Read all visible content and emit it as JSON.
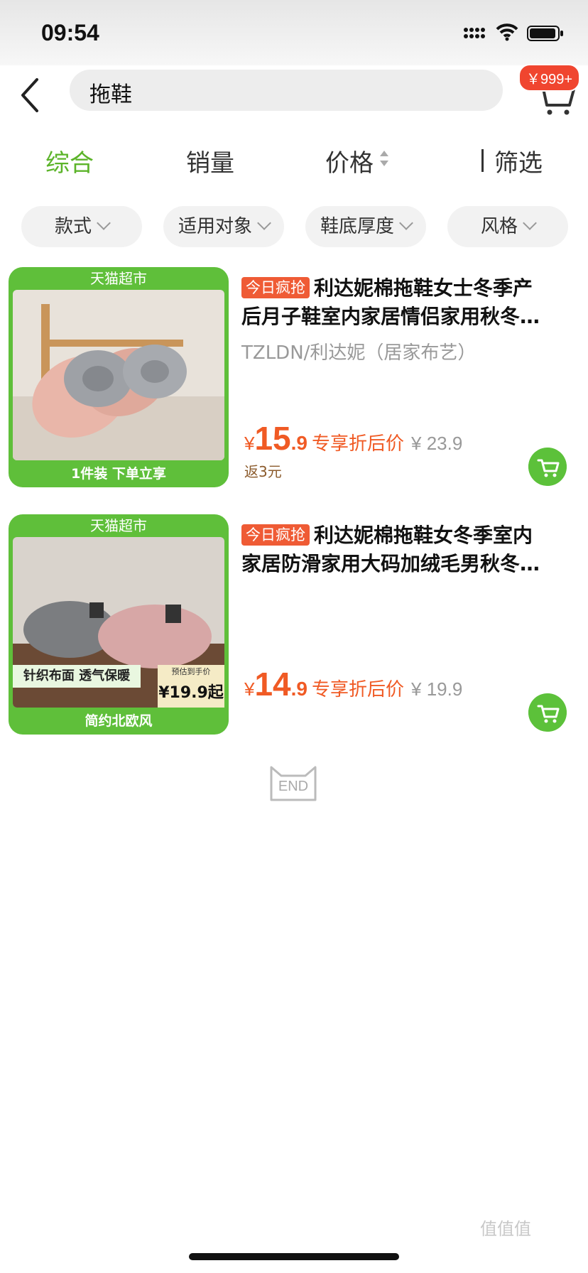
{
  "status_bar": {
    "time": "09:54"
  },
  "header": {
    "search_query": "拖鞋",
    "cart_badge": "￥999+"
  },
  "sort_tabs": [
    {
      "label": "综合",
      "active": true
    },
    {
      "label": "销量",
      "active": false
    },
    {
      "label": "价格",
      "active": false
    },
    {
      "label": "筛选",
      "active": false
    }
  ],
  "filter_chips": [
    "款式",
    "适用对象",
    "鞋底厚度",
    "风格"
  ],
  "products": [
    {
      "thumb_top": "天猫超市",
      "thumb_bottom": "1件装   下单立享",
      "promo": "今日疯抢",
      "title_line1": "利达妮棉拖鞋女士冬季产",
      "title_line2": "后月子鞋室内家居情侣家用秋冬…",
      "brand": "TZLDN/利达妮（居家布艺）",
      "currency": "¥",
      "price_int": "15",
      "price_dec": ".9",
      "price_label": "专享折后价",
      "original_price": "¥ 23.9",
      "rebate": "返3元"
    },
    {
      "thumb_top": "天猫超市",
      "thumb_bottom": "简约北欧风",
      "thumb_overlay_left": "针织布面 透气保暖",
      "thumb_overlay_right_small": "预估到手价",
      "thumb_overlay_right_price": "¥19.9起",
      "promo": "今日疯抢",
      "title_line1": "利达妮棉拖鞋女冬季室内",
      "title_line2": "家居防滑家用大码加绒毛男秋冬…",
      "currency": "¥",
      "price_int": "14",
      "price_dec": ".9",
      "price_label": "专享折后价",
      "original_price": "¥ 19.9"
    }
  ],
  "end_mark": "END",
  "watermark": "值值值",
  "colors": {
    "accent_green": "#5cb42a",
    "price_orange": "#f05a24",
    "badge_red": "#f0452f"
  }
}
